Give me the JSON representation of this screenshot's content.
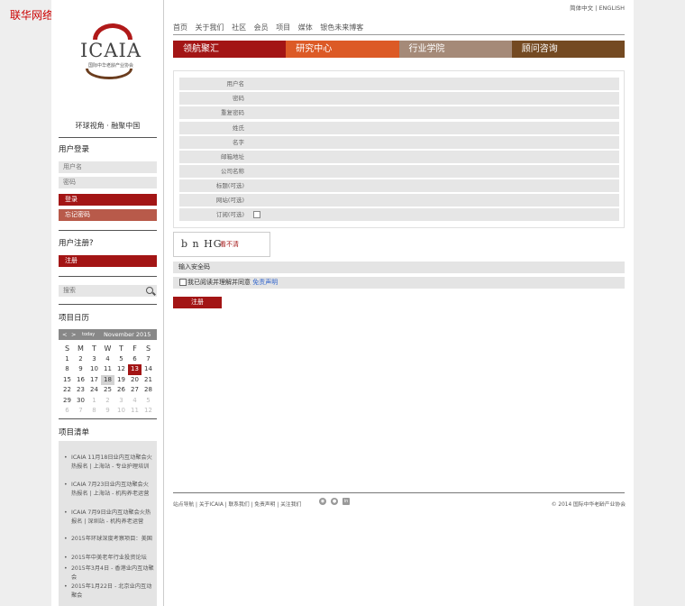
{
  "watermark": "联华网络",
  "logo": {
    "name": "ICAIA",
    "sub": "国际中华老龄产业协会"
  },
  "slogan": "环球视角 · 融聚中国",
  "login": {
    "title": "用户登录",
    "username_placeholder": "用户名",
    "password_placeholder": "密码",
    "login_label": "登录",
    "forgot_label": "忘记密码"
  },
  "register_side": {
    "title": "用户注册?",
    "register_label": "注册"
  },
  "search": {
    "placeholder": "搜索"
  },
  "calendar": {
    "title": "项目日历",
    "prev": "<",
    "next": ">",
    "today": "today",
    "month": "November 2015",
    "dow": [
      "S",
      "M",
      "T",
      "W",
      "T",
      "F",
      "S"
    ],
    "weeks": [
      [
        [
          "1",
          ""
        ],
        [
          "2",
          ""
        ],
        [
          "3",
          ""
        ],
        [
          "4",
          ""
        ],
        [
          "5",
          ""
        ],
        [
          "6",
          ""
        ],
        [
          "7",
          ""
        ]
      ],
      [
        [
          "8",
          ""
        ],
        [
          "9",
          ""
        ],
        [
          "10",
          ""
        ],
        [
          "11",
          ""
        ],
        [
          "12",
          ""
        ],
        [
          "13",
          "today"
        ],
        [
          "14",
          ""
        ]
      ],
      [
        [
          "15",
          ""
        ],
        [
          "16",
          ""
        ],
        [
          "17",
          ""
        ],
        [
          "18",
          "sel"
        ],
        [
          "19",
          ""
        ],
        [
          "20",
          ""
        ],
        [
          "21",
          ""
        ]
      ],
      [
        [
          "22",
          ""
        ],
        [
          "23",
          ""
        ],
        [
          "24",
          ""
        ],
        [
          "25",
          ""
        ],
        [
          "26",
          ""
        ],
        [
          "27",
          ""
        ],
        [
          "28",
          ""
        ]
      ],
      [
        [
          "29",
          ""
        ],
        [
          "30",
          ""
        ],
        [
          "1",
          "dim"
        ],
        [
          "2",
          "dim"
        ],
        [
          "3",
          "dim"
        ],
        [
          "4",
          "dim"
        ],
        [
          "5",
          "dim"
        ]
      ],
      [
        [
          "6",
          "dim"
        ],
        [
          "7",
          "dim"
        ],
        [
          "8",
          "dim"
        ],
        [
          "9",
          "dim"
        ],
        [
          "10",
          "dim"
        ],
        [
          "11",
          "dim"
        ],
        [
          "12",
          "dim"
        ]
      ]
    ]
  },
  "projects": {
    "title": "项目清单",
    "items": [
      "ICAIA 11月18日业内互动聚会火热报名 | 上海站 - 专业护理培训",
      "ICAIA 7月23日业内互动聚会火热报名 | 上海站 - 机构养老运营",
      "ICAIA 7月9日业内互动聚会火热报名 | 深圳站 - 机构养老运营",
      "2015年环球深度考察项目：美国",
      "2015年中美老年行业投资论坛",
      "2015年3月4日 - 香港业内互动聚会",
      "2015年1月22日 - 北京业内互动聚会"
    ]
  },
  "lang": {
    "zh": "简体中文",
    "sep": "|",
    "en": "ENGLISH"
  },
  "nav": [
    "首页",
    "关于我们",
    "社区",
    "会员",
    "项目",
    "媒体",
    "银色未来博客"
  ],
  "tabs": [
    {
      "label": "领航聚汇",
      "color": "#a31515"
    },
    {
      "label": "研究中心",
      "color": "#dc5a26"
    },
    {
      "label": "行业学院",
      "color": "#a58a78"
    },
    {
      "label": "顾问咨询",
      "color": "#744a22"
    }
  ],
  "form": {
    "fields": [
      "用户名",
      "密码",
      "重复密码",
      "姓氏",
      "名字",
      "邮箱地址",
      "公司名称",
      "标题(可选)",
      "网站(可选)",
      "订阅(可选)"
    ]
  },
  "captcha": {
    "code": "b n HG",
    "refresh": "看不清",
    "input_label": "输入安全码"
  },
  "agree": {
    "text": "我已阅读并理解并同意",
    "link": "免责声明"
  },
  "submit_label": "注册",
  "footer": {
    "links": "站点导航 | 关于ICAIA | 联系我们 | 免责声明 | 关注我们",
    "copyright": "© 2014 国际中华老龄产业协会"
  }
}
